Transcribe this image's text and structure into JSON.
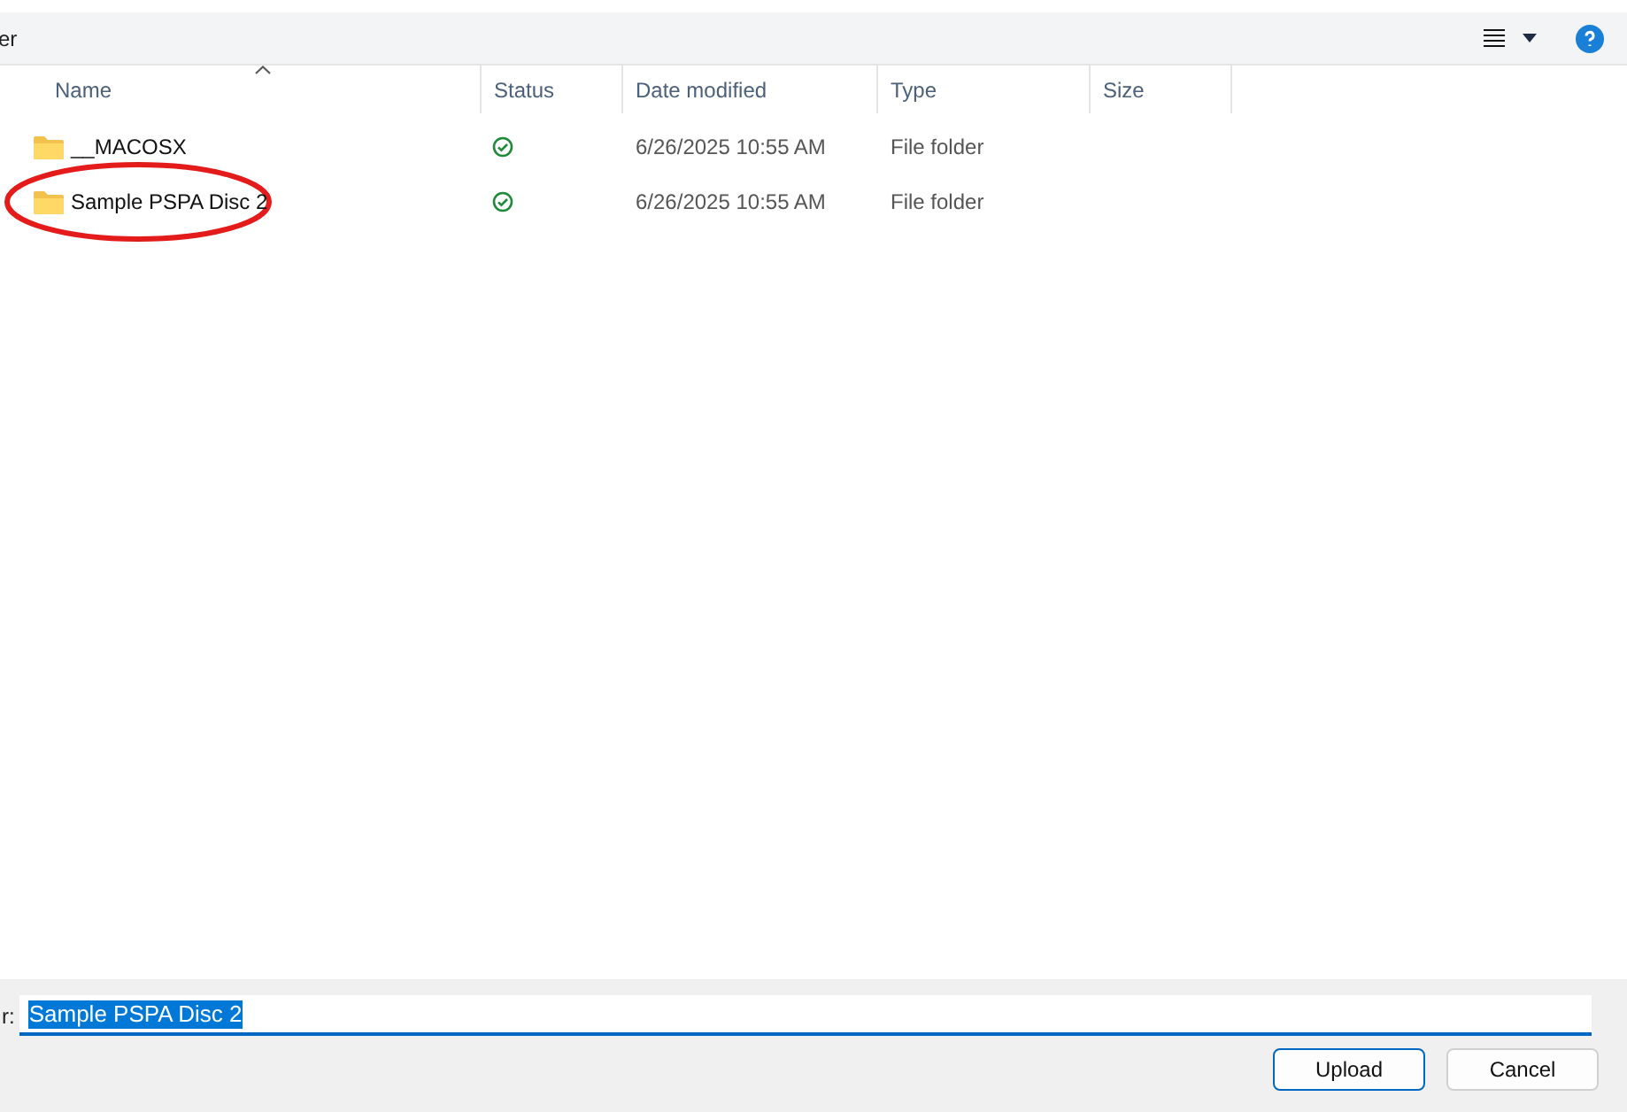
{
  "toolbar": {
    "title": "er"
  },
  "table": {
    "columns": [
      {
        "label": "Name",
        "sorted": true
      },
      {
        "label": "Status",
        "sorted": false
      },
      {
        "label": "Date modified",
        "sorted": false
      },
      {
        "label": "Type",
        "sorted": false
      },
      {
        "label": "Size",
        "sorted": false
      }
    ],
    "rows": [
      {
        "name": "__MACOSX",
        "date": "6/26/2025 10:55 AM",
        "type": "File folder",
        "circled": false
      },
      {
        "name": "Sample PSPA Disc 2",
        "date": "6/26/2025 10:55 AM",
        "type": "File folder",
        "circled": true
      }
    ]
  },
  "footer": {
    "label": "r:",
    "value": "Sample PSPA Disc 2",
    "buttons": [
      {
        "label": "Upload",
        "kind": "primary"
      },
      {
        "label": "Cancel",
        "kind": "secondary"
      }
    ]
  }
}
